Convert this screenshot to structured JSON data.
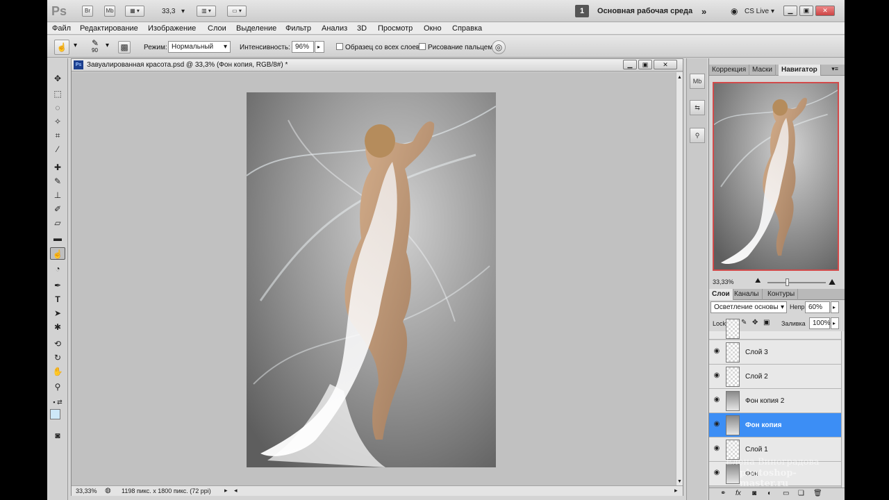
{
  "app": {
    "logo": "Ps",
    "bridge_btn": "Br",
    "minibridge_btn": "Mb",
    "zoom_value": "33,3",
    "workspace_number": "1",
    "workspace_name": "Основная рабочая среда",
    "cslive": "CS Live"
  },
  "menu": [
    "Файл",
    "Редактирование",
    "Изображение",
    "Слои",
    "Выделение",
    "Фильтр",
    "Анализ",
    "3D",
    "Просмотр",
    "Окно",
    "Справка"
  ],
  "options": {
    "brush_size": "90",
    "mode_label": "Режим:",
    "mode_value": "Нормальный",
    "intensity_label": "Интенсивность:",
    "intensity_value": "96%",
    "sample_all_label": "Образец со всех слоев",
    "finger_label": "Рисование пальцем"
  },
  "document": {
    "title": "Завуалированная красота.psd @ 33,3% (Фон копия, RGB/8#) *",
    "status_zoom": "33,33%",
    "status_info": "1198 пикс. x 1800 пикс. (72 ppi)"
  },
  "panels": {
    "top_tabs": [
      "Коррекция",
      "Маски",
      "Навигатор"
    ],
    "navigator_zoom": "33,33%",
    "layer_tabs": [
      "Слои",
      "Каналы",
      "Контуры"
    ],
    "blend_mode": "Осветление основы",
    "opacity_label": "Непр",
    "opacity_value": "60%",
    "lock_label": "Lock",
    "fill_label": "Заливка",
    "fill_value": "100%",
    "layers": [
      {
        "name": "Слой 3",
        "thumb": "transparent",
        "selected": false
      },
      {
        "name": "Слой 2",
        "thumb": "transparent",
        "selected": false
      },
      {
        "name": "Фон копия 2",
        "thumb": "photo",
        "selected": false
      },
      {
        "name": "Фон копия",
        "thumb": "photo",
        "selected": true
      },
      {
        "name": "Слой 1",
        "thumb": "transparent",
        "selected": false
      },
      {
        "name": "Фон",
        "thumb": "photo",
        "selected": false
      }
    ],
    "watermark_line1": "Елена Виноградова",
    "watermark_line2": "photoshop-master.ru"
  }
}
